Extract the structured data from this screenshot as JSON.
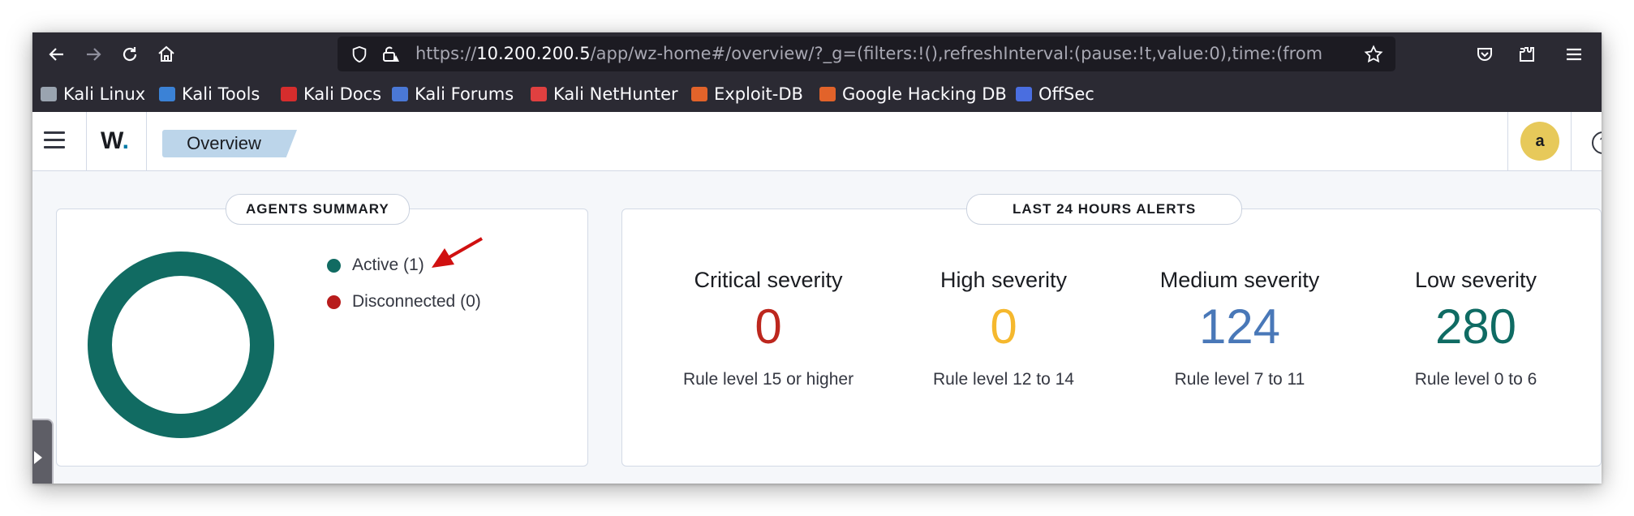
{
  "browser": {
    "url_prefix": "https://",
    "url_host": "10.200.200.5",
    "url_rest": "/app/wz-home#/overview/?_g=(filters:!(),refreshInterval:(pause:!t,value:0),time:(from:",
    "icons": {
      "back": "arrow-left-icon",
      "forward": "arrow-right-icon",
      "reload": "reload-icon",
      "home": "home-icon",
      "shield": "shield-icon",
      "lock": "lock-icon",
      "bookmark_star": "star-icon",
      "pocket": "pocket-icon",
      "extensions": "extensions-icon",
      "menu": "menu-icon"
    },
    "bookmarks": [
      {
        "label": "Kali Linux",
        "color": "#9aa4b0"
      },
      {
        "label": "Kali Tools",
        "color": "#3b82d6"
      },
      {
        "label": "Kali Docs",
        "color": "#d62d2d"
      },
      {
        "label": "Kali Forums",
        "color": "#4a78d6"
      },
      {
        "label": "Kali NetHunter",
        "color": "#e04040"
      },
      {
        "label": "Exploit-DB",
        "color": "#e2632a"
      },
      {
        "label": "Google Hacking DB",
        "color": "#e2632a"
      },
      {
        "label": "OffSec",
        "color": "#4a6ee0"
      }
    ]
  },
  "app": {
    "logo_text": "W",
    "logo_dot": ".",
    "breadcrumb": "Overview",
    "avatar_initial": "a",
    "help_glyph": "?"
  },
  "agents_summary": {
    "title": "AGENTS SUMMARY",
    "legend": [
      {
        "label": "Active (1)",
        "color": "#116b62",
        "count": 1
      },
      {
        "label": "Disconnected (0)",
        "color": "#b81c1c",
        "count": 0
      }
    ]
  },
  "alerts": {
    "title": "LAST 24 HOURS ALERTS",
    "severities": [
      {
        "title": "Critical severity",
        "value": "0",
        "subtitle": "Rule level 15 or higher",
        "color": "#bd271e"
      },
      {
        "title": "High severity",
        "value": "0",
        "subtitle": "Rule level 12 to 14",
        "color": "#f5b82e"
      },
      {
        "title": "Medium severity",
        "value": "124",
        "subtitle": "Rule level 7 to 11",
        "color": "#4978b8"
      },
      {
        "title": "Low severity",
        "value": "280",
        "subtitle": "Rule level 0 to 6",
        "color": "#0f6b63"
      }
    ]
  },
  "annotation": {
    "arrow_color": "#d01010"
  }
}
